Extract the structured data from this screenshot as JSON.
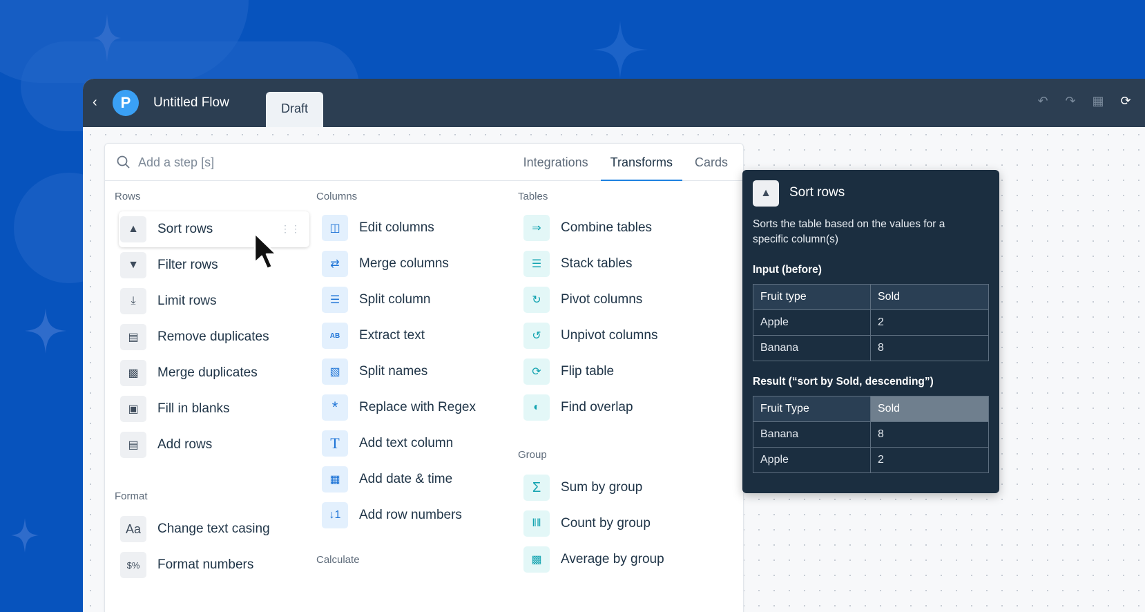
{
  "app": {
    "title": "Untitled Flow",
    "logo_letter": "P",
    "draft_tab": "Draft"
  },
  "toolbar": {
    "icons": [
      "undo-icon",
      "redo-icon",
      "save-icon",
      "refresh-icon",
      "more-vertical-icon"
    ]
  },
  "search": {
    "placeholder": "Add a step [s]"
  },
  "tabs": [
    {
      "label": "Integrations",
      "active": false
    },
    {
      "label": "Transforms",
      "active": true
    },
    {
      "label": "Cards",
      "active": false
    }
  ],
  "sections": {
    "rows": "Rows",
    "format": "Format",
    "columns": "Columns",
    "calculate": "Calculate",
    "tables": "Tables",
    "group": "Group"
  },
  "rows": [
    "Sort rows",
    "Filter rows",
    "Limit rows",
    "Remove duplicates",
    "Merge duplicates",
    "Fill in blanks",
    "Add rows"
  ],
  "format": [
    "Change text casing",
    "Format numbers"
  ],
  "columns": [
    "Edit columns",
    "Merge columns",
    "Split column",
    "Extract text",
    "Split names",
    "Replace with Regex",
    "Add text column",
    "Add date & time",
    "Add row numbers"
  ],
  "tables": [
    "Combine tables",
    "Stack tables",
    "Pivot columns",
    "Unpivot columns",
    "Flip table",
    "Find overlap"
  ],
  "group": [
    "Sum by group",
    "Count by group",
    "Average by group"
  ],
  "detail": {
    "title": "Sort rows",
    "description": "Sorts the table based on the values for a specific column(s)",
    "input_heading": "Input (before)",
    "input_table": {
      "headers": [
        "Fruit type",
        "Sold"
      ],
      "rows": [
        [
          "Apple",
          "2"
        ],
        [
          "Banana",
          "8"
        ]
      ]
    },
    "result_heading": "Result (“sort by Sold, descending”)",
    "result_table": {
      "headers": [
        "Fruit Type",
        "Sold"
      ],
      "rows": [
        [
          "Banana",
          "8"
        ],
        [
          "Apple",
          "2"
        ]
      ]
    }
  },
  "colors": {
    "background": "#0753bd",
    "topbar": "#2c3e52",
    "accent": "#1d82e0",
    "detail_bg": "#1b2e40"
  }
}
